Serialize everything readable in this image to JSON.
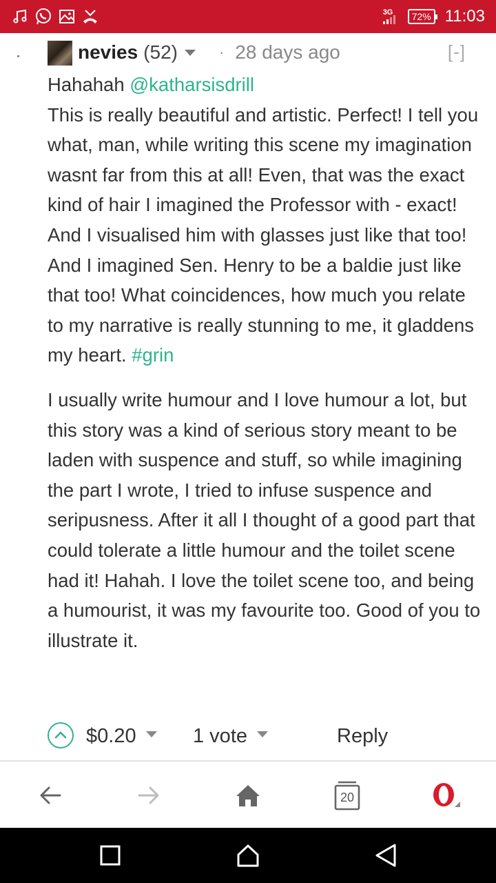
{
  "status_bar": {
    "network": "3G",
    "battery": "72%",
    "time": "11:03",
    "left_icons": [
      "music-note-icon",
      "whatsapp-icon",
      "image-icon",
      "missed-call-icon"
    ]
  },
  "comment": {
    "author": "nevies",
    "reputation": "(52)",
    "separator": "·",
    "time_ago": "28 days ago",
    "collapse_label": "[-]",
    "greeting": "Hahahah ",
    "mention": "@katharsisdrill",
    "paragraph1": "This is really beautiful and artistic. Perfect! I tell you what, man, while writing this scene my imagination wasnt far from this at all! Even, that was the exact kind of hair I imagined the Professor with - exact! And I visualised him with glasses just like that too! And I imagined Sen. Henry to be a baldie just like that too! What coincidences, how much you relate to my narrative is really stunning to me, it gladdens my heart. ",
    "hashtag": "#grin",
    "paragraph2": "I usually write humour and I love humour a lot, but this story was a kind of serious story meant to be laden with suspence and stuff, so while imagining the part I wrote, I tried to infuse suspence and seripusness. After it all I thought of a good part that could tolerate a little humour and the toilet scene had it! Hahah. I love the toilet scene too, and being a humourist, it was my favourite too. Good of you to illustrate it."
  },
  "actions": {
    "payout": "$0.20",
    "votes": "1 vote",
    "reply": "Reply"
  },
  "browser_bar": {
    "tab_count": "20",
    "buttons": [
      "back-arrow-icon",
      "forward-arrow-icon",
      "home-icon",
      "tabs-icon",
      "opera-menu-icon"
    ]
  },
  "colors": {
    "status_bar": "#c8172a",
    "accent_green": "#2eb38d",
    "text": "#333333",
    "muted": "#888888"
  }
}
